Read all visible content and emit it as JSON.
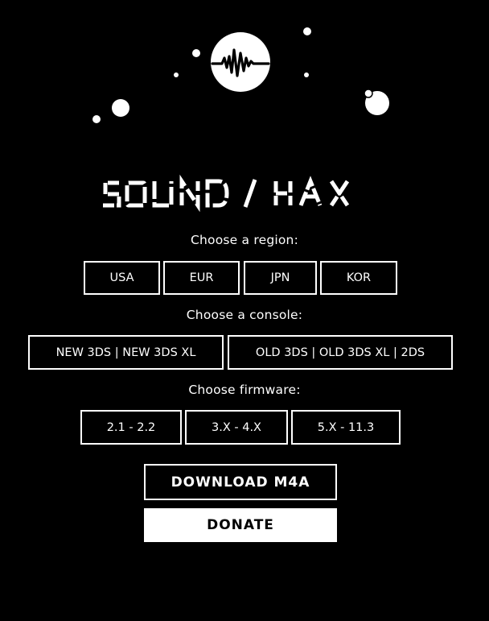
{
  "brand": {
    "logo_text": "SOUND/HAX"
  },
  "region": {
    "label": "Choose a region:",
    "options": [
      "USA",
      "EUR",
      "JPN",
      "KOR"
    ]
  },
  "console": {
    "label": "Choose a console:",
    "options": [
      "NEW 3DS | NEW 3DS XL",
      "OLD 3DS | OLD 3DS XL | 2DS"
    ]
  },
  "firmware": {
    "label": "Choose firmware:",
    "options": [
      "2.1 - 2.2",
      "3.X - 4.X",
      "5.X - 11.3"
    ]
  },
  "actions": {
    "download_label": "DOWNLOAD M4A",
    "donate_label": "DONATE"
  },
  "colors": {
    "background": "#000000",
    "foreground": "#ffffff"
  },
  "icons": {
    "logo_icon": "waveform-icon"
  }
}
